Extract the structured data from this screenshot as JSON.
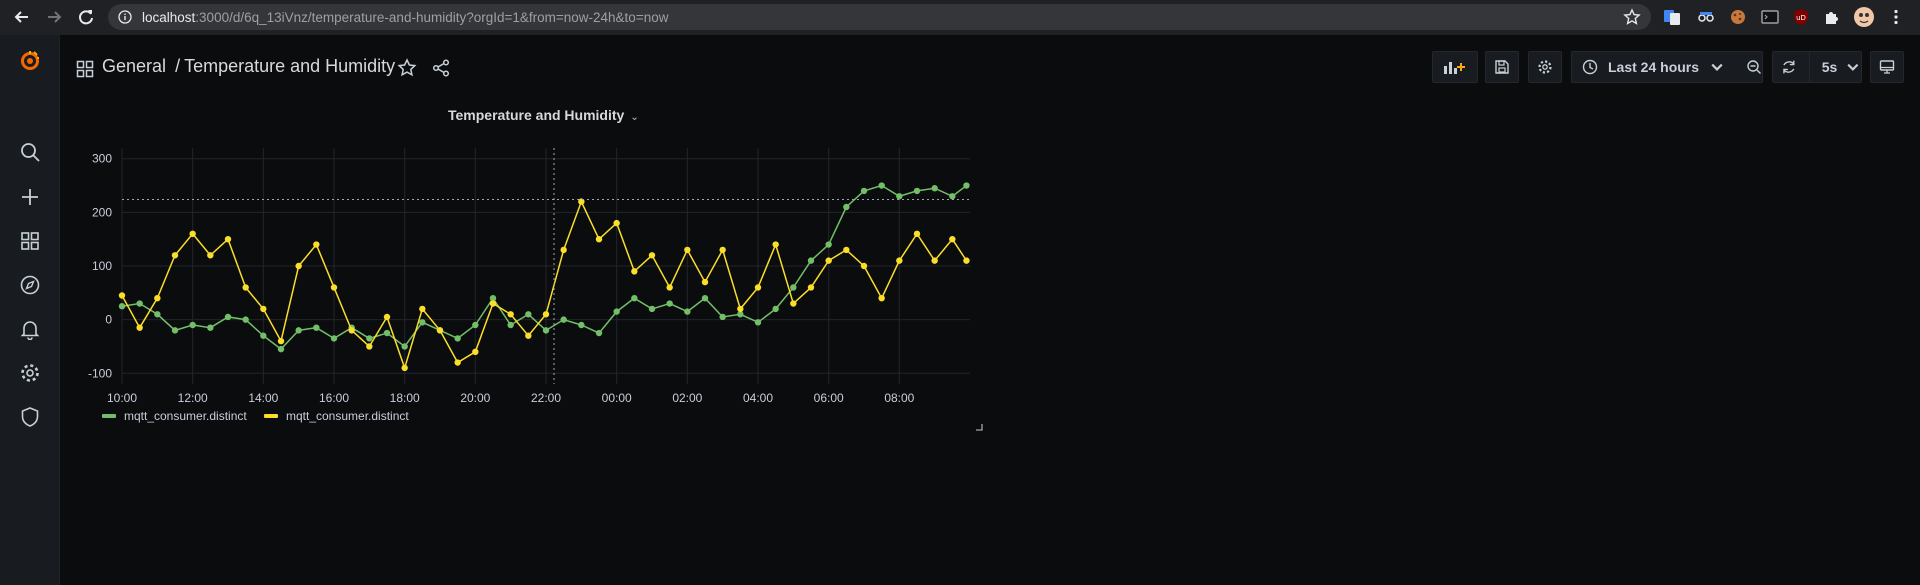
{
  "browser": {
    "url_host": "localhost",
    "url_rest": ":3000/d/6q_13iVnz/temperature-and-humidity?orgId=1&from=now-24h&to=now"
  },
  "sidebar": {
    "items": [
      {
        "icon": "grafana-logo-icon"
      },
      {
        "icon": "search-icon"
      },
      {
        "icon": "plus-icon"
      },
      {
        "icon": "dashboards-icon"
      },
      {
        "icon": "compass-icon"
      },
      {
        "icon": "bell-icon"
      },
      {
        "icon": "gear-icon"
      },
      {
        "icon": "shield-icon"
      }
    ]
  },
  "header": {
    "folder": "General",
    "separator": "/",
    "dashboard_title": "Temperature and Humidity",
    "time_range": "Last 24 hours",
    "refresh_interval": "5s"
  },
  "panel": {
    "title": "Temperature and Humidity"
  },
  "chart_data": {
    "type": "line",
    "title": "Temperature and Humidity",
    "ylim": [
      -120,
      320
    ],
    "y_ticks": [
      "300",
      "200",
      "100",
      "0",
      "-100"
    ],
    "x_ticks": [
      "10:00",
      "12:00",
      "14:00",
      "16:00",
      "18:00",
      "20:00",
      "22:00",
      "00:00",
      "02:00",
      "04:00",
      "06:00",
      "08:00"
    ],
    "grid": true,
    "legend_placement": "bottom-left",
    "series": [
      {
        "name": "mqtt_consumer.distinct",
        "color": "#73bf69",
        "x": [
          10.0,
          10.5,
          11.0,
          11.5,
          12.0,
          12.5,
          13.0,
          13.5,
          14.0,
          14.5,
          15.0,
          15.5,
          16.0,
          16.5,
          17.0,
          17.5,
          18.0,
          18.5,
          19.0,
          19.5,
          20.0,
          20.5,
          21.0,
          21.5,
          22.0,
          22.5,
          23.0,
          23.5,
          24.0,
          24.5,
          25.0,
          25.5,
          26.0,
          26.5,
          27.0,
          27.5,
          28.0,
          28.5,
          29.0,
          29.5,
          30.0,
          30.5,
          31.0,
          31.5,
          32.0,
          32.5,
          33.0,
          33.5,
          33.9
        ],
        "values": [
          25,
          30,
          10,
          -20,
          -10,
          -15,
          5,
          0,
          -30,
          -55,
          -20,
          -15,
          -35,
          -15,
          -35,
          -25,
          -50,
          -5,
          -20,
          -35,
          -10,
          40,
          -10,
          10,
          -20,
          0,
          -10,
          -25,
          15,
          40,
          20,
          30,
          15,
          40,
          5,
          10,
          -5,
          20,
          60,
          110,
          140,
          210,
          240,
          250,
          230,
          240,
          245,
          230,
          250
        ]
      },
      {
        "name": "mqtt_consumer.distinct",
        "color": "#fade2a",
        "x": [
          10.0,
          10.5,
          11.0,
          11.5,
          12.0,
          12.5,
          13.0,
          13.5,
          14.0,
          14.5,
          15.0,
          15.5,
          16.0,
          16.5,
          17.0,
          17.5,
          18.0,
          18.5,
          19.0,
          19.5,
          20.0,
          20.5,
          21.0,
          21.5,
          22.0,
          22.5,
          23.0,
          23.5,
          24.0,
          24.5,
          25.0,
          25.5,
          26.0,
          26.5,
          27.0,
          27.5,
          28.0,
          28.5,
          29.0,
          29.5,
          30.0,
          30.5,
          31.0,
          31.5,
          32.0,
          32.5,
          33.0,
          33.5,
          33.9
        ],
        "values": [
          45,
          -15,
          40,
          120,
          160,
          120,
          150,
          60,
          20,
          -40,
          100,
          140,
          60,
          -20,
          -50,
          5,
          -90,
          20,
          -20,
          -80,
          -60,
          30,
          10,
          -30,
          10,
          130,
          220,
          150,
          180,
          90,
          120,
          60,
          130,
          70,
          130,
          20,
          60,
          140,
          30,
          60,
          110,
          130,
          100,
          40,
          110,
          160,
          110,
          150,
          110
        ]
      }
    ]
  }
}
